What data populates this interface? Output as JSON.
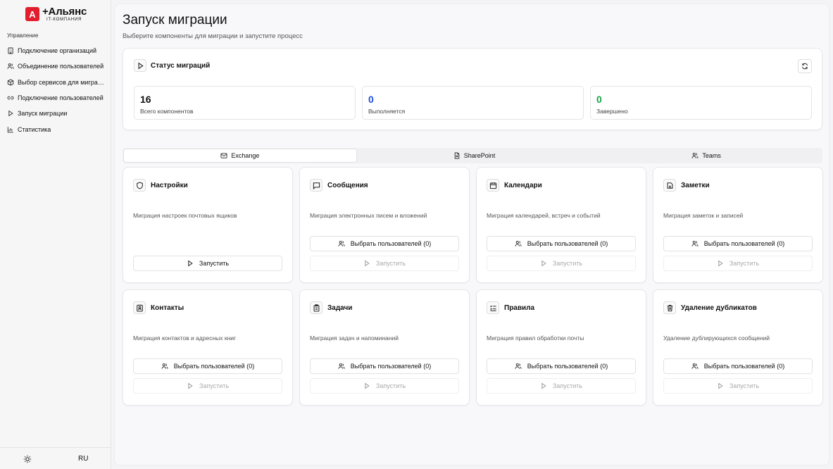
{
  "brand": {
    "mark": "A",
    "name": "+Альянс",
    "sub": "IT-КОМПАНИЯ",
    "color": "#e11d2e"
  },
  "sidebar": {
    "section": "Управление",
    "items": [
      {
        "label": "Подключение организаций",
        "icon": "building-icon"
      },
      {
        "label": "Объединение пользователей",
        "icon": "users-icon"
      },
      {
        "label": "Выбор сервисов для миграции",
        "icon": "box-icon"
      },
      {
        "label": "Подключение пользователей",
        "icon": "link-icon"
      },
      {
        "label": "Запуск миграции",
        "icon": "play-icon"
      },
      {
        "label": "Статистика",
        "icon": "chart-icon"
      }
    ],
    "lang": "RU"
  },
  "page": {
    "title": "Запуск миграции",
    "subtitle": "Выберите компоненты для миграции и запустите процесс"
  },
  "status": {
    "title": "Статус миграций",
    "stats": [
      {
        "value": "16",
        "label": "Всего компонентов",
        "color": "#111111"
      },
      {
        "value": "0",
        "label": "Выполняется",
        "color": "#1d4ed8"
      },
      {
        "value": "0",
        "label": "Завершено",
        "color": "#16a34a"
      }
    ]
  },
  "tabs": [
    {
      "label": "Exchange",
      "icon": "mail-icon",
      "active": true
    },
    {
      "label": "SharePoint",
      "icon": "file-icon",
      "active": false
    },
    {
      "label": "Teams",
      "icon": "users-icon",
      "active": false
    }
  ],
  "cards": [
    {
      "title": "Настройки",
      "icon": "shield-icon",
      "desc": "Миграция настроек почтовых ящиков",
      "users_label": "",
      "run_label": "Запустить",
      "run_enabled": true
    },
    {
      "title": "Сообщения",
      "icon": "message-icon",
      "desc": "Миграция электронных писем и вложений",
      "users_label": "Выбрать пользователей (0)",
      "run_label": "Запустить",
      "run_enabled": false
    },
    {
      "title": "Календари",
      "icon": "calendar-icon",
      "desc": "Миграция календарей, встреч и событий",
      "users_label": "Выбрать пользователей (0)",
      "run_label": "Запустить",
      "run_enabled": false
    },
    {
      "title": "Заметки",
      "icon": "notes-icon",
      "desc": "Миграция заметок и записей",
      "users_label": "Выбрать пользователей (0)",
      "run_label": "Запустить",
      "run_enabled": false
    },
    {
      "title": "Контакты",
      "icon": "contacts-icon",
      "desc": "Миграция контактов и адресных книг",
      "users_label": "Выбрать пользователей (0)",
      "run_label": "Запустить",
      "run_enabled": false
    },
    {
      "title": "Задачи",
      "icon": "clipboard-icon",
      "desc": "Миграция задач и напоминаний",
      "users_label": "Выбрать пользователей (0)",
      "run_label": "Запустить",
      "run_enabled": false
    },
    {
      "title": "Правила",
      "icon": "rules-icon",
      "desc": "Миграция правил обработки почты",
      "users_label": "Выбрать пользователей (0)",
      "run_label": "Запустить",
      "run_enabled": false
    },
    {
      "title": "Удаление дубликатов",
      "icon": "trash-icon",
      "desc": "Удаление дублирующихся сообщений",
      "users_label": "Выбрать пользователей (0)",
      "run_label": "Запустить",
      "run_enabled": false
    }
  ]
}
